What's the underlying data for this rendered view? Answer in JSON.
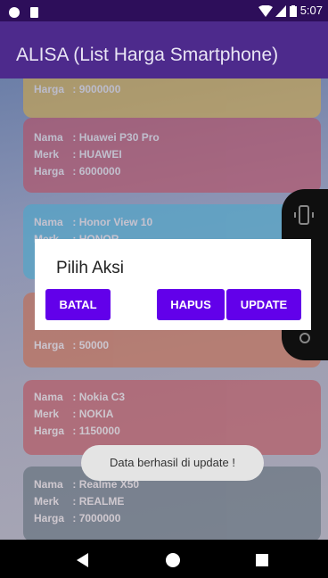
{
  "statusbar": {
    "time": "5:07",
    "icons": [
      "record-dot-icon",
      "sd-card-icon",
      "wifi-icon",
      "signal-icon",
      "battery-icon"
    ]
  },
  "appbar": {
    "title": "ALISA (List Harga Smartphone)"
  },
  "cards": [
    {
      "nama": "",
      "merk": "",
      "harga": "9000000",
      "color": "#cfa84a"
    },
    {
      "nama": "Huawei P30 Pro",
      "merk": "HUAWEI",
      "harga": "6000000",
      "color": "#b84e62"
    },
    {
      "nama": "Honor View 10",
      "merk": "HONOR",
      "harga": "",
      "color": "#4aa9cc"
    },
    {
      "nama": "",
      "merk": "",
      "harga": "50000",
      "color": "#c46a4e"
    },
    {
      "nama": "Nokia C3",
      "merk": "NOKIA",
      "harga": "1150000",
      "color": "#b8505a"
    },
    {
      "nama": "Realme X50",
      "merk": "REALME",
      "harga": "7000000",
      "color": "#5f6d79"
    }
  ],
  "labels": {
    "nama": "Nama",
    "merk": "Merk",
    "harga": "Harga",
    "sep": ": "
  },
  "dialog": {
    "title": "Pilih Aksi",
    "batal": "BATAL",
    "hapus": "HAPUS",
    "update": "UPDATE"
  },
  "toast": {
    "message": "Data berhasil di update !"
  },
  "colors": {
    "accent": "#6200ea",
    "appbar": "#4d2a8c",
    "statusbar": "#2d0e5a"
  }
}
